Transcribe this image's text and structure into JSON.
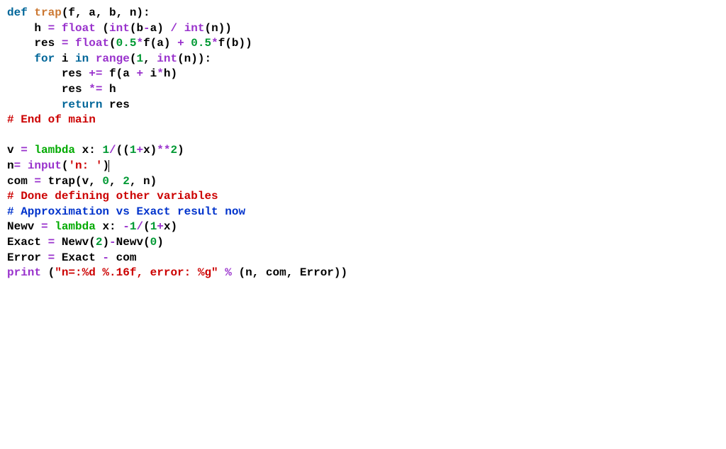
{
  "code": {
    "l1": {
      "def": "def ",
      "name": "trap",
      "sig": "(f, a, b, n):"
    },
    "l2": {
      "indent": "    ",
      "a": "h ",
      "eq": "= ",
      "fl": "float ",
      "p1": "(",
      "int1": "int",
      "p2": "(b",
      "minus": "-",
      "p3": "a) ",
      "slash": "/",
      "sp": " ",
      "int2": "int",
      "p4": "(n))"
    },
    "l3": {
      "indent": "    ",
      "a": "res ",
      "eq": "= ",
      "fl": "float",
      "p1": "(",
      "n1": "0.5",
      "m1": "*",
      "f1": "f(a) ",
      "plus": "+",
      "sp": " ",
      "n2": "0.5",
      "m2": "*",
      "f2": "f(b))"
    },
    "l4": {
      "indent": "    ",
      "for": "for ",
      "i": "i ",
      "in": "in ",
      "range": "range",
      "p1": "(",
      "n1": "1",
      "c": ", ",
      "int": "int",
      "p2": "(n)):"
    },
    "l5": {
      "indent": "        ",
      "a": "res ",
      "peq": "+= ",
      "f": "f(a ",
      "plus": "+",
      "sp": " i",
      "mul": "*",
      "h": "h)"
    },
    "l6": {
      "indent": "        ",
      "a": "res ",
      "meq": "*= ",
      "h": "h"
    },
    "l7": {
      "indent": "        ",
      "ret": "return ",
      "res": "res"
    },
    "l8": {
      "text": "# End of main"
    },
    "l9": {
      "text": ""
    },
    "l10": {
      "a": "v ",
      "eq": "= ",
      "lam": "lambda ",
      "x": "x: ",
      "n1": "1",
      "slash": "/",
      "p1": "((",
      "n2": "1",
      "plus": "+",
      "p2": "x)",
      "pow": "**",
      "n3": "2",
      "p3": ")"
    },
    "l11": {
      "a": "n",
      "eq": "= ",
      "inp": "input",
      "p1": "(",
      "s": "'n: '",
      "p2": ")"
    },
    "l12": {
      "a": "com ",
      "eq": "= ",
      "f": "trap(v, ",
      "n1": "0",
      "c": ", ",
      "n2": "2",
      "p": ", n)"
    },
    "l13": {
      "text": "# Done defining other variables"
    },
    "l14": {
      "text": "# Approximation vs Exact result now"
    },
    "l15": {
      "a": "Newv ",
      "eq": "= ",
      "lam": "lambda ",
      "x": "x: ",
      "neg": "-",
      "n1": "1",
      "slash": "/",
      "p1": "(",
      "n2": "1",
      "plus": "+",
      "p2": "x)"
    },
    "l16": {
      "a": "Exact ",
      "eq": "= ",
      "f": "Newv(",
      "n1": "2",
      "p1": ")",
      "minus": "-",
      "g": "Newv(",
      "n2": "0",
      "p2": ")"
    },
    "l17": {
      "a": "Error ",
      "eq": "= ",
      "b": "Exact ",
      "minus": "-",
      "c": " com"
    },
    "l18": {
      "pr": "print ",
      "p1": "(",
      "s": "\"n=:%d %.16f, error: %g\"",
      "sp": " ",
      "pct": "%",
      "t": " (n, com, Error))"
    }
  }
}
